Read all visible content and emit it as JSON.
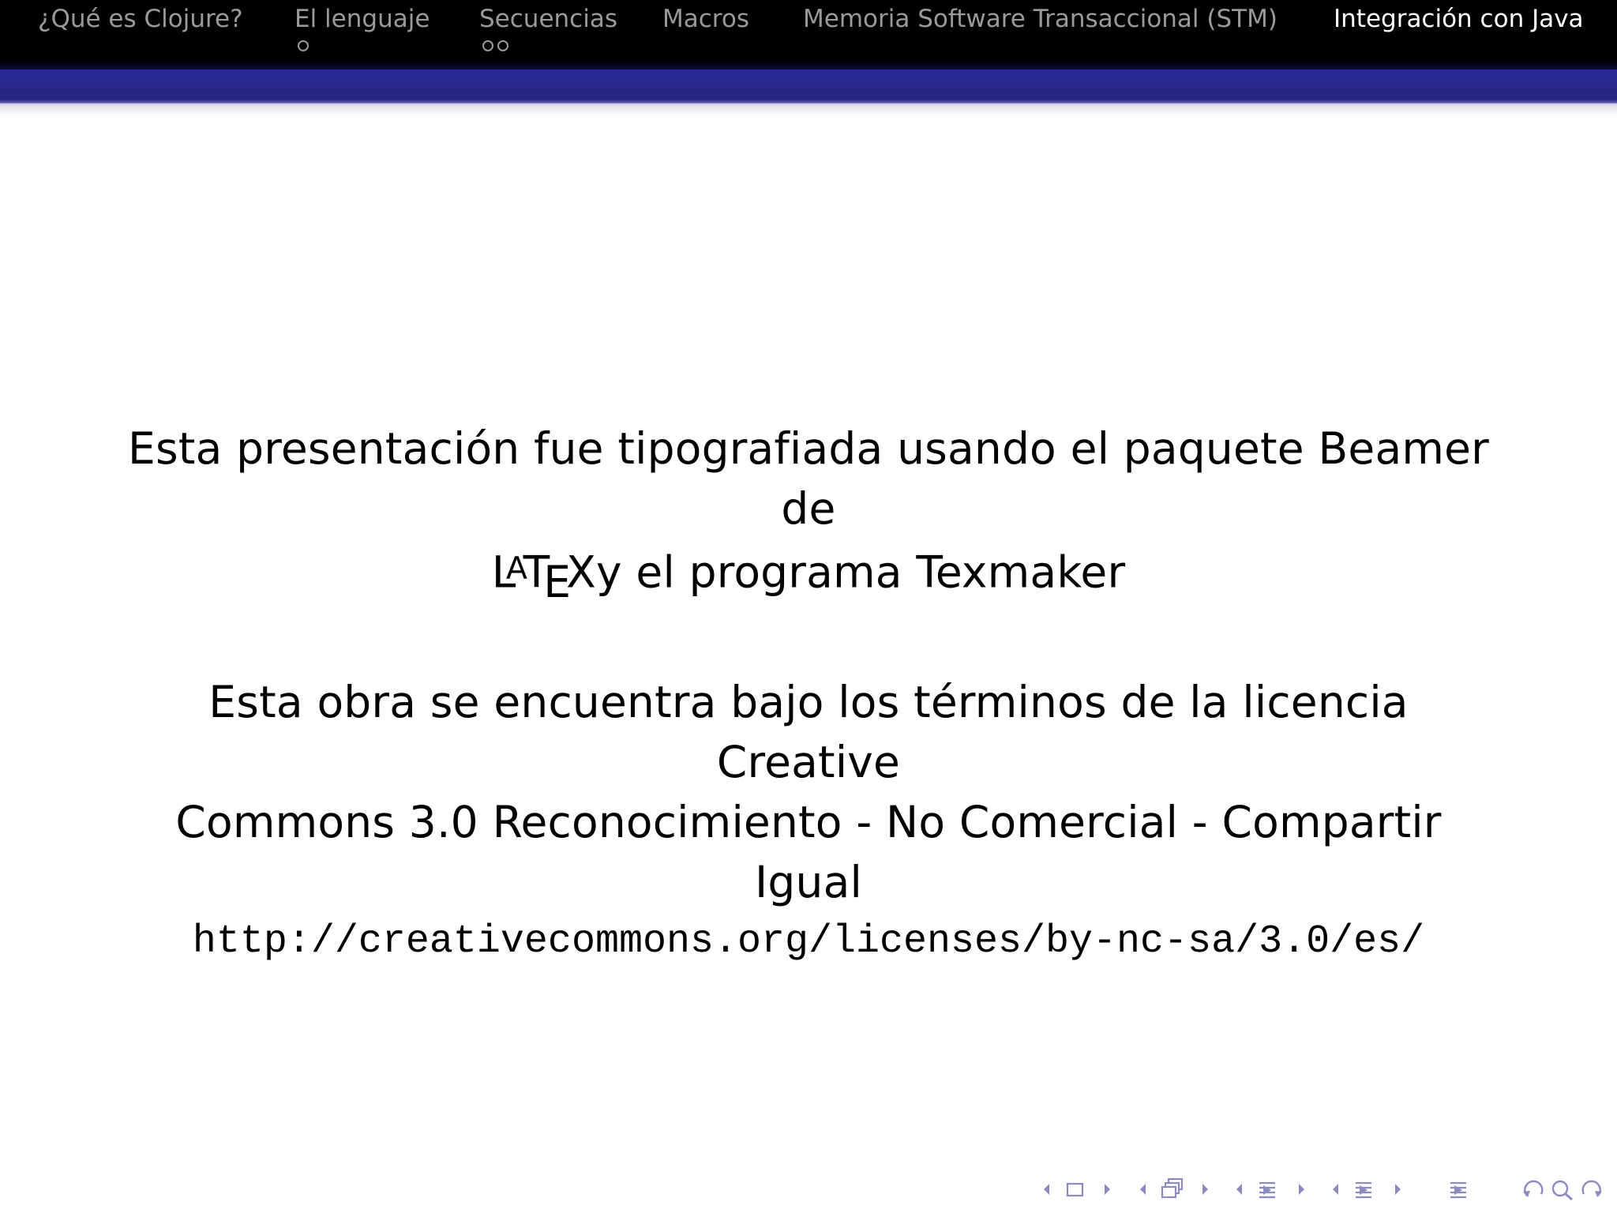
{
  "header": {
    "sections": [
      {
        "label": "¿Qué es Clojure?",
        "dots": 0,
        "active": false
      },
      {
        "label": "El lenguaje",
        "dots": 1,
        "active": false
      },
      {
        "label": "Secuencias",
        "dots": 2,
        "active": false
      },
      {
        "label": "Macros",
        "dots": 0,
        "active": false
      },
      {
        "label": "Memoria Software Transaccional (STM)",
        "dots": 0,
        "active": false
      },
      {
        "label": "Integración con Java",
        "dots": 0,
        "active": true
      }
    ]
  },
  "main": {
    "paragraph1_text": "Esta presentación fue tipografiada usando el paquete Beamer de",
    "paragraph1_logo": "LaTeX",
    "paragraph1_rest": "y el programa Texmaker",
    "paragraph2_line1": "Esta obra se encuentra bajo los términos de la licencia Creative",
    "paragraph2_line2": "Commons 3.0 Reconocimiento - No Comercial - Compartir Igual",
    "license_url": "http://creativecommons.org/licenses/by-nc-sa/3.0/es/"
  },
  "footer_nav": {
    "icons": [
      "arrow-left-icon",
      "slide-icon",
      "arrow-right-icon",
      "arrow-left-icon",
      "frame-icon",
      "arrow-right-icon",
      "arrow-left-icon",
      "subsection-icon",
      "arrow-right-icon",
      "arrow-left-icon",
      "section-icon",
      "arrow-right-icon",
      "align-icon",
      "undo-icon",
      "search-icon",
      "redo-icon"
    ]
  },
  "colors": {
    "header_bg": "#000000",
    "band": "#262682",
    "nav_inactive": "#9a9a9a",
    "nav_active": "#ffffff",
    "footer_nav": "#8b8bbf"
  }
}
